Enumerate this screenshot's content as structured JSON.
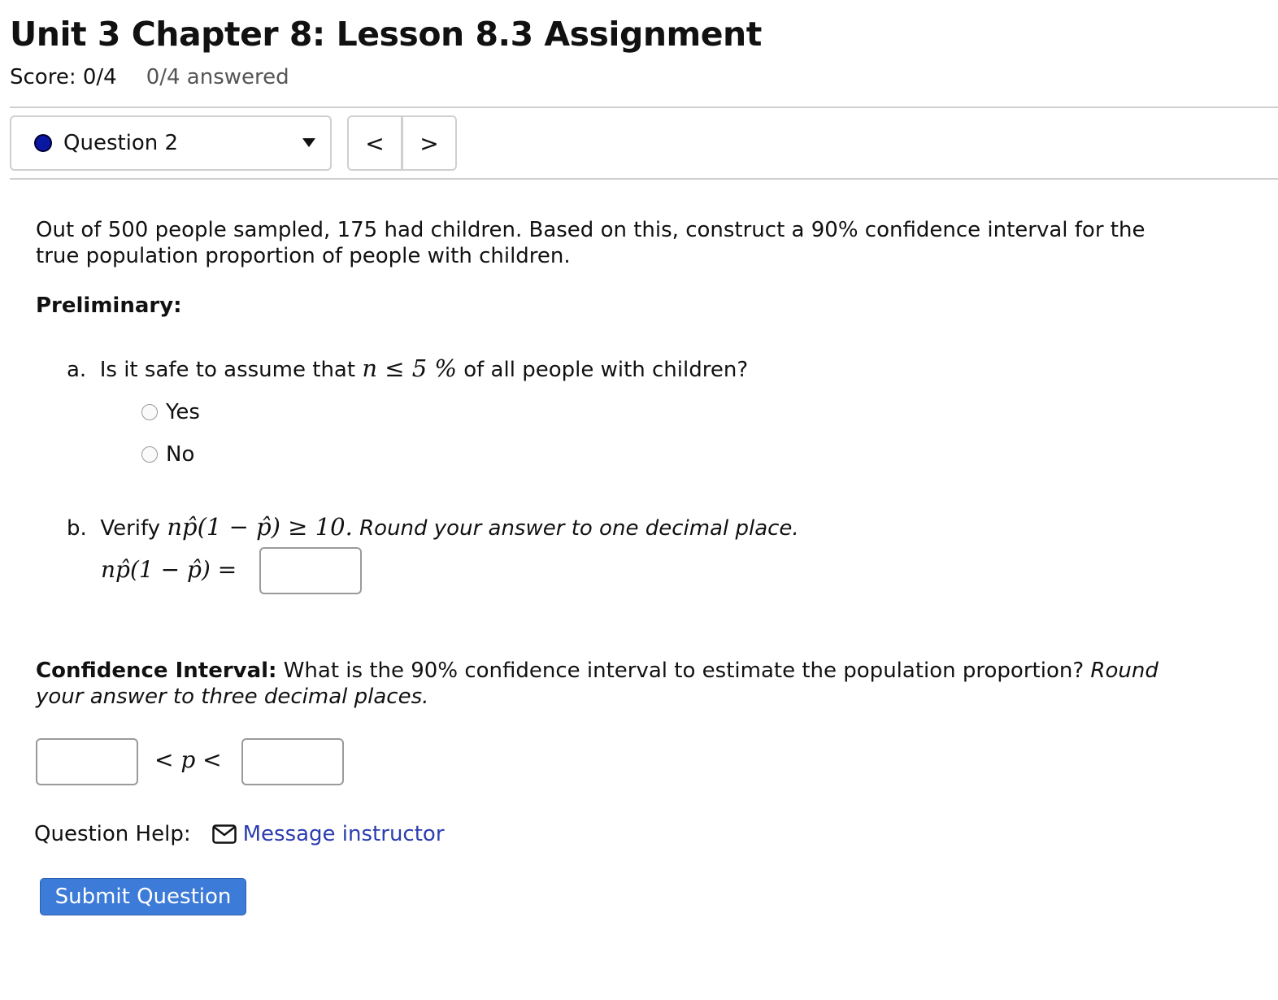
{
  "header": {
    "title": "Unit 3 Chapter 8: Lesson 8.3 Assignment",
    "score": "Score: 0/4",
    "answered": "0/4 answered"
  },
  "nav": {
    "question_label": "Question 2",
    "prev_label": "<",
    "next_label": ">",
    "status_color": "#0a17a0"
  },
  "question": {
    "prompt": "Out of 500 people sampled, 175 had children. Based on this, construct a 90% confidence interval for the true population proportion of people with children.",
    "preliminary_label": "Preliminary:",
    "part_a": {
      "marker": "a.",
      "text_before": "Is it safe to assume that",
      "math": "n ≤ 5 %",
      "text_after": "of all people with children?",
      "options": [
        "Yes",
        "No"
      ]
    },
    "part_b": {
      "marker": "b.",
      "text_before": "Verify",
      "math": "np̂(1 − p̂) ≥ 10.",
      "instruction": "Round your answer to one decimal place.",
      "equation_lhs": "np̂(1 − p̂) =",
      "value": ""
    },
    "ci": {
      "label": "Confidence Interval:",
      "text": "What is the 90% confidence interval to estimate the population proportion?",
      "instruction": "Round your answer to three decimal places.",
      "middle": "< p <",
      "lower_value": "",
      "upper_value": ""
    }
  },
  "help": {
    "label": "Question Help:",
    "message_link": "Message instructor"
  },
  "submit_label": "Submit Question",
  "colors": {
    "link": "#2b3db0",
    "submit": "#3d7bd8"
  }
}
